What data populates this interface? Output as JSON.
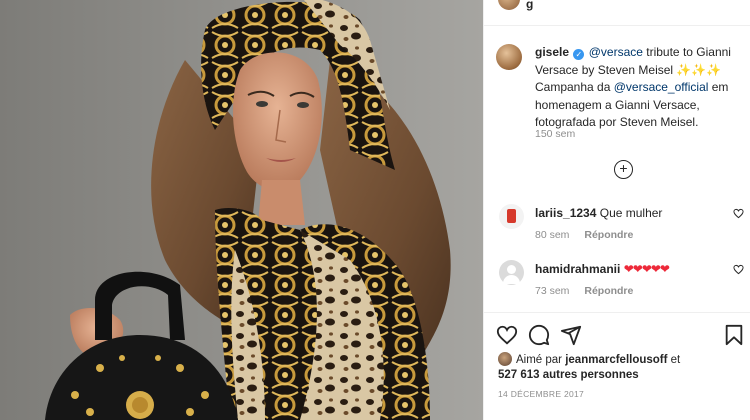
{
  "header": {
    "username": "g"
  },
  "caption": {
    "username": "gisele",
    "mention_1": "@versace",
    "text_1": " tribute to Gianni Versace by Steven Meisel ",
    "sparkles": "✨✨✨",
    "text_2": " Campanha da ",
    "mention_2": "@versace_official",
    "text_3": " em homenagem a Gianni Versace, fotografada por Steven Meisel.",
    "time": "150 sem"
  },
  "more_comments_icon": "plus-circle-icon",
  "comments": [
    {
      "username": "lariis_1234",
      "text": "Que mulher",
      "time": "80 sem",
      "reply": "Répondre"
    },
    {
      "username": "hamidrahmanii",
      "text": "❤❤❤❤❤",
      "time": "73 sem",
      "reply": "Répondre"
    }
  ],
  "actions": {
    "like": "heart-icon",
    "comment": "comment-icon",
    "share": "share-icon",
    "save": "bookmark-icon"
  },
  "likes": {
    "prefix": "Aimé par ",
    "user": "jeanmarcfellousoff",
    "conjunction": " et",
    "count": "527 613 autres personnes"
  },
  "date": "14 DÉCEMBRE 2017",
  "colors": {
    "link": "#00376b",
    "meta": "#8e8e8e",
    "verified": "#3897f0",
    "heart": "#ed2939"
  }
}
